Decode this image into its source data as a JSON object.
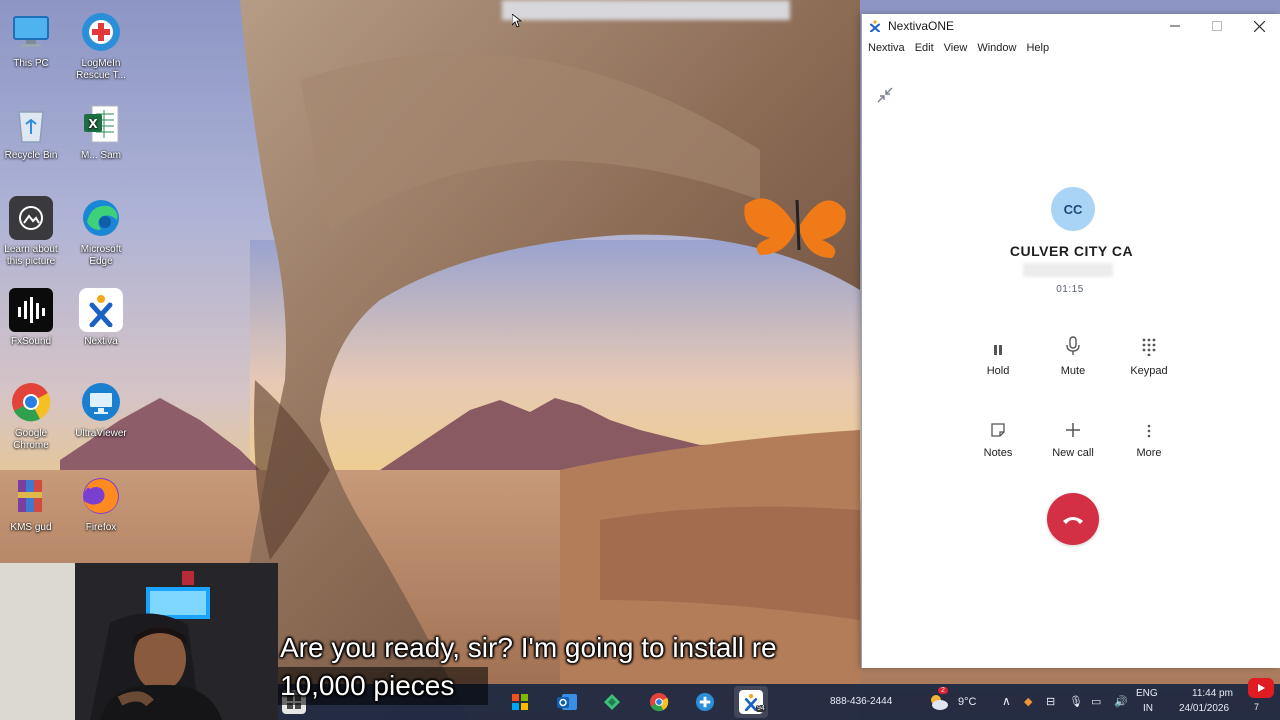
{
  "desktop": {
    "icons": [
      {
        "label": "This PC",
        "icon": "computer-icon"
      },
      {
        "label": "LogMeIn Rescue T...",
        "icon": "logmein-rescue-icon"
      },
      {
        "label": "Recycle Bin",
        "icon": "recycle-bin-icon"
      },
      {
        "label": "M... Sam",
        "icon": "excel-file-icon"
      },
      {
        "label": "Learn about this picture",
        "icon": "camera-icon"
      },
      {
        "label": "Microsoft Edge",
        "icon": "edge-icon"
      },
      {
        "label": "FxSound",
        "icon": "fxsound-icon"
      },
      {
        "label": "Nextiva",
        "icon": "nextiva-icon"
      },
      {
        "label": "Google Chrome",
        "icon": "chrome-icon"
      },
      {
        "label": "UltraViewer",
        "icon": "ultraviewer-icon"
      },
      {
        "label": "KMS gud",
        "icon": "winrar-archive-icon"
      },
      {
        "label": "Firefox",
        "icon": "firefox-icon"
      }
    ]
  },
  "nextiva": {
    "title": "NextivaONE",
    "menu": [
      "Nextiva",
      "Edit",
      "View",
      "Window",
      "Help"
    ],
    "call": {
      "initials": "CC",
      "caller_name": "CULVER CITY CA",
      "timer": "01:15"
    },
    "actions": {
      "hold": "Hold",
      "mute": "Mute",
      "keypad": "Keypad",
      "notes": "Notes",
      "new_call": "New call",
      "more": "More"
    },
    "colors": {
      "hangup": "#d32f45",
      "avatar": "#a9d4f5"
    }
  },
  "subtitles": {
    "line1": "Are you ready, sir? I'm going to install re",
    "line2": "10,000 pieces"
  },
  "taskbar": {
    "phone_number": "888-436-2444",
    "weather_temp": "9°C",
    "weather_badge": "2",
    "language": "ENG",
    "region": "IN",
    "time": "11:44 pm",
    "date": "24/01/2026",
    "notification_count": "7",
    "nextiva_badge": "94"
  }
}
